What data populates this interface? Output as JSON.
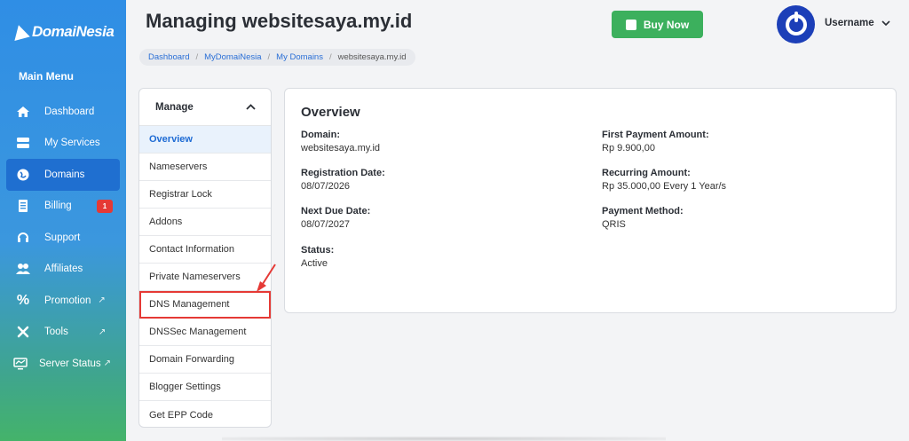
{
  "sidebar": {
    "brand": "DomaiNesia",
    "main_menu_label": "Main Menu",
    "items": [
      {
        "label": "Dashboard",
        "icon": "home-icon"
      },
      {
        "label": "My Services",
        "icon": "server-icon"
      },
      {
        "label": "Domains",
        "icon": "globe-icon",
        "active": true
      },
      {
        "label": "Billing",
        "icon": "invoice-icon",
        "badge": "1"
      },
      {
        "label": "Support",
        "icon": "headset-icon"
      },
      {
        "label": "Affiliates",
        "icon": "users-icon"
      },
      {
        "label": "Promotion",
        "icon": "percent-icon",
        "external": true
      },
      {
        "label": "Tools",
        "icon": "tools-icon",
        "external": true
      },
      {
        "label": "Server Status",
        "icon": "monitor-icon",
        "external": true
      }
    ]
  },
  "header": {
    "title": "Managing websitesaya.my.id",
    "buy_label": "Buy Now",
    "username": "Username"
  },
  "breadcrumb": [
    "Dashboard",
    "MyDomaiNesia",
    "My Domains",
    "websitesaya.my.id"
  ],
  "manage": {
    "title": "Manage",
    "items": [
      "Overview",
      "Nameservers",
      "Registrar Lock",
      "Addons",
      "Contact Information",
      "Private Nameservers",
      "DNS Management",
      "DNSSec Management",
      "Domain Forwarding",
      "Blogger Settings",
      "Get EPP Code"
    ],
    "active_index": 0,
    "highlight_index": 6
  },
  "overview": {
    "title": "Overview",
    "domain_label": "Domain:",
    "domain_value": "websitesaya.my.id",
    "reg_label": "Registration Date:",
    "reg_value": "08/07/2026",
    "due_label": "Next Due Date:",
    "due_value": "08/07/2027",
    "status_label": "Status:",
    "status_value": "Active",
    "first_label": "First Payment Amount:",
    "first_value": "Rp 9.900,00",
    "recurring_label": "Recurring Amount:",
    "recurring_value": "Rp 35.000,00 Every 1 Year/s",
    "method_label": "Payment Method:",
    "method_value": "QRIS"
  },
  "colors": {
    "accent": "#1e6bd4",
    "buy_button": "#3cb05d",
    "highlight": "#e53935"
  }
}
